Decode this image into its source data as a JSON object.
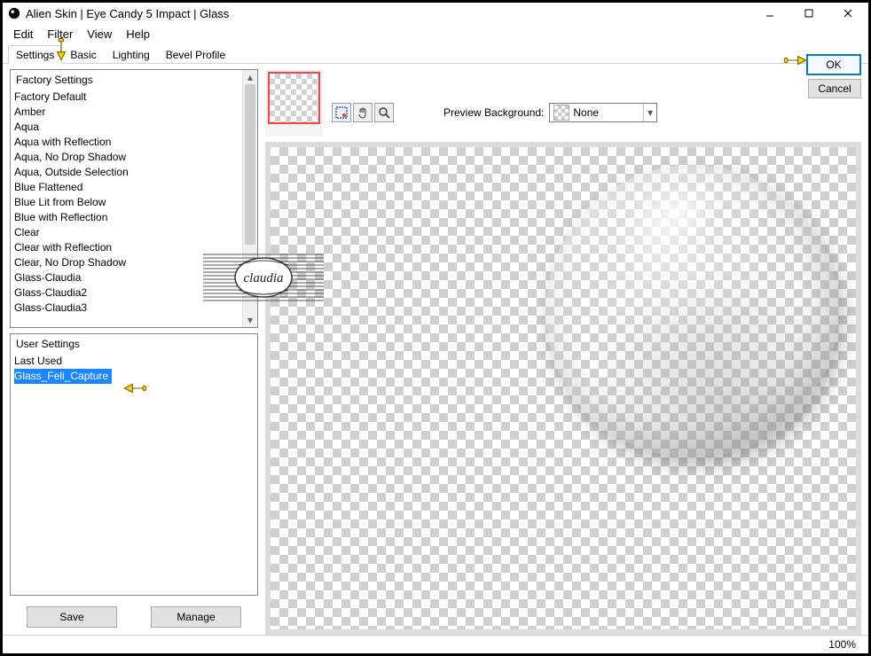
{
  "window": {
    "title": "Alien Skin | Eye Candy 5 Impact | Glass"
  },
  "menu": {
    "edit": "Edit",
    "filter": "Filter",
    "view": "View",
    "help": "Help"
  },
  "tabs": {
    "settings": "Settings",
    "basic": "Basic",
    "lighting": "Lighting",
    "bevel": "Bevel Profile"
  },
  "factory": {
    "header": "Factory Settings",
    "items": [
      "Factory Default",
      "Amber",
      "Aqua",
      "Aqua with Reflection",
      "Aqua, No Drop Shadow",
      "Aqua, Outside Selection",
      "Blue Flattened",
      "Blue Lit from Below",
      "Blue with Reflection",
      "Clear",
      "Clear with Reflection",
      "Clear, No Drop Shadow",
      "Glass-Claudia",
      "Glass-Claudia2",
      "Glass-Claudia3"
    ]
  },
  "user": {
    "header": "User Settings",
    "items": [
      "Last Used",
      "Glass_Feli_Capture"
    ],
    "selected_index": 1
  },
  "buttons": {
    "save": "Save",
    "manage": "Manage",
    "ok": "OK",
    "cancel": "Cancel"
  },
  "preview": {
    "label": "Preview Background:",
    "selected": "None"
  },
  "status": {
    "zoom": "100%"
  },
  "watermark": "claudia"
}
